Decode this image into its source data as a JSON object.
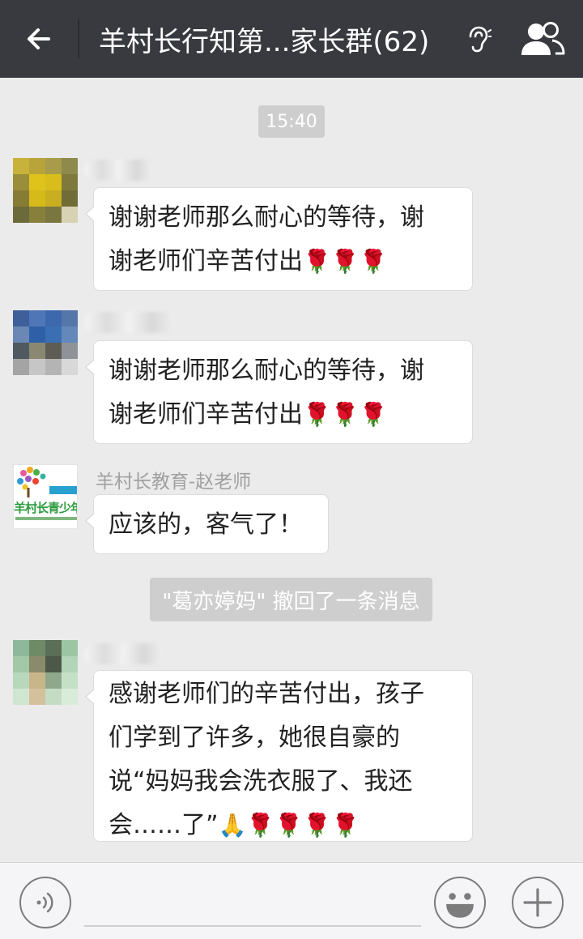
{
  "header": {
    "title": "羊村长行知第...家长群(62)",
    "back_icon": "back-arrow-icon",
    "ear_icon": "earpiece-mode-icon",
    "members_icon": "group-members-icon"
  },
  "chat": {
    "timestamp": "15:40",
    "messages": [
      {
        "sender": "",
        "text": "谢谢老师那么耐心的等待，谢\n谢老师们辛苦付出",
        "emoji": "🌹🌹🌹"
      },
      {
        "sender": "",
        "text": "谢谢老师那么耐心的等待，谢\n谢老师们辛苦付出",
        "emoji": "🌹🌹🌹"
      },
      {
        "sender": "羊村长教育-赵老师",
        "text": "应该的，客气了！",
        "emoji": ""
      },
      {
        "sender": "",
        "text": "感谢老师们的辛苦付出，孩子\n们学到了许多，她很自豪的\n说“妈妈我会洗衣服了、我还\n会……了”",
        "emoji": "🙏🌹🌹🌹🌹"
      }
    ],
    "system_notice": "\"葛亦婷妈\" 撤回了一条消息",
    "logo_text": "羊村长青少年"
  },
  "input_bar": {
    "voice_icon": "voice-input-icon",
    "emoji_icon": "emoji-face-icon",
    "more_icon": "plus-icon",
    "placeholder": ""
  },
  "colors": {
    "header_bg": "#393a3f",
    "chat_bg": "#ebebeb",
    "bubble_bg": "#ffffff",
    "system_bg": "#cecece"
  }
}
